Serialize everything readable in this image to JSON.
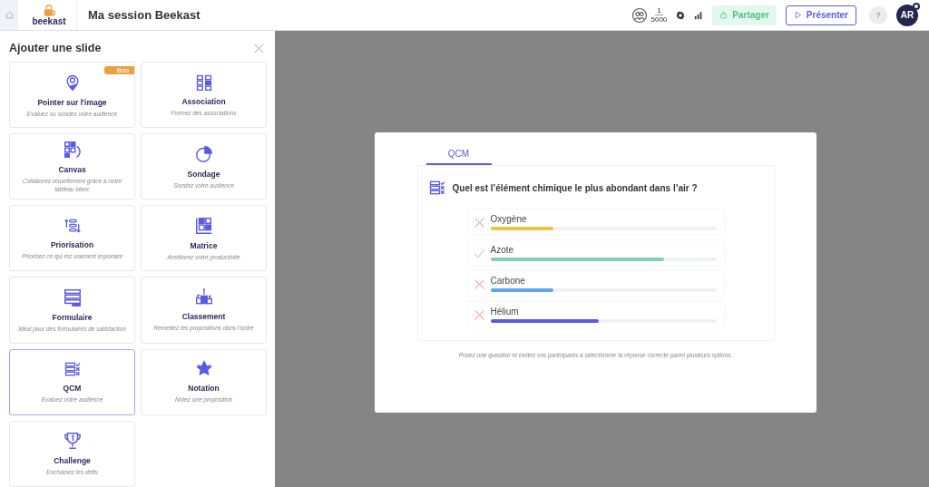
{
  "topbar": {
    "logo_text": "beekast",
    "title": "Ma session Beekast",
    "participants": {
      "count": "1",
      "max": "5000"
    },
    "share_button": "Partager",
    "present_button": "Présenter",
    "help_button": "?",
    "avatar": "AR"
  },
  "sidebar": {
    "title": "Ajouter une slide",
    "cards": [
      {
        "title": "Pointer sur l'image",
        "description": "Evaluez ou sondez votre audience",
        "badge": "Beta",
        "selected": false
      },
      {
        "title": "Association",
        "description": "Formez des associations",
        "selected": false
      },
      {
        "title": "Canvas",
        "description": "Collaborez visuellement grâce à notre tableau blanc",
        "selected": false
      },
      {
        "title": "Sondage",
        "description": "Sondez votre audience",
        "selected": false
      },
      {
        "title": "Priorisation",
        "description": "Priorisez ce qui est vraiment important",
        "selected": false
      },
      {
        "title": "Matrice",
        "description": "Améliorez votre productivité",
        "selected": false
      },
      {
        "title": "Formulaire",
        "description": "Idéal pour des formulaires de satisfaction",
        "selected": false
      },
      {
        "title": "Classement",
        "description": "Remettez les propositions dans l'ordre",
        "selected": false
      },
      {
        "title": "QCM",
        "description": "Evaluez votre audience",
        "selected": true
      },
      {
        "title": "Notation",
        "description": "Notez une proposition",
        "selected": false
      },
      {
        "title": "Challenge",
        "description": "Enchaînez les défis",
        "selected": false
      }
    ]
  },
  "preview": {
    "tabs": [
      {
        "label": "QCM",
        "selected": true
      }
    ],
    "question": "Quel est l’élément chimique le plus abondant dans l’air ?",
    "options": [
      {
        "label": "Oxygène",
        "correct": false,
        "level": 0.28,
        "color": "#e9c545"
      },
      {
        "label": "Azote",
        "correct": true,
        "level": 0.77,
        "color": "#7fd0b3"
      },
      {
        "label": "Carbone",
        "correct": false,
        "level": 0.28,
        "color": "#5ea6e6"
      },
      {
        "label": "Hélium",
        "correct": false,
        "level": 0.48,
        "color": "#5b5be0"
      }
    ],
    "description": "Posez une question et invitez vos participants à sélectionner la réponse correcte parmi plusieurs options."
  }
}
